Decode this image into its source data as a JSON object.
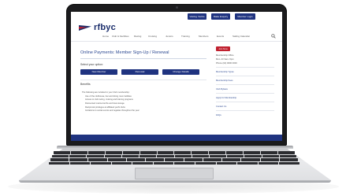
{
  "site": {
    "logo_text": "rfbyc",
    "utility_buttons": [
      "Visiting Yachts",
      "Make Enquiry",
      "Member Login"
    ],
    "nav": {
      "items": [
        "Home",
        "Club & Facilities",
        "Racing",
        "Cruising",
        "Juniors",
        "Training",
        "Members",
        "Events",
        "Sailing Calendar"
      ],
      "search_icon": "search-icon"
    },
    "main": {
      "title": "Online Payments: Member Sign-Up / Renewal",
      "subtitle": "Select your option:",
      "buttons": [
        "New Member",
        "Renewal",
        "Change Details"
      ],
      "section_heading": "Benefits",
      "lines": [
        "The following are included in your Club membership:",
        "Use of the clubhouse, bar and dining room facilities",
        "Access to club racing, cruising and training programs",
        "Discounted marina berths and boat storage",
        "Reciprocal privileges at affiliated yacht clubs",
        "Invitations to social events and regattas throughout the year"
      ]
    },
    "sidebar": {
      "action_button": "Join Now",
      "text_lines": [
        "Membership Office",
        "Mon–Fri 9am–5pm",
        "Phone (02) 0000 0000"
      ],
      "links": [
        "Membership Types",
        "Membership Fees",
        "Club Bylaws",
        "Apply for Membership",
        "Contact Us",
        "FAQs"
      ]
    }
  },
  "colors": {
    "brand_navy": "#1f3380",
    "link_blue": "#2f4b93",
    "accent_red": "#c0212f",
    "laptop_bezel": "#1b1b1d"
  }
}
